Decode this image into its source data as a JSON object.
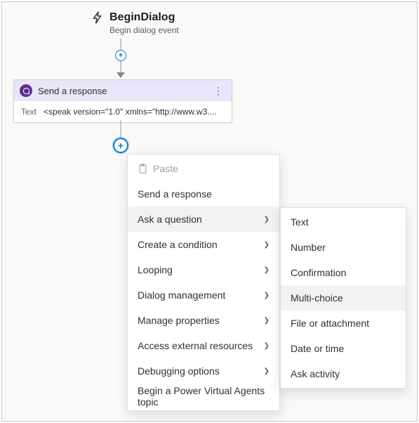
{
  "trigger": {
    "title": "BeginDialog",
    "subtitle": "Begin dialog event"
  },
  "node": {
    "title": "Send a response",
    "field_label": "Text",
    "field_value": "<speak version=\"1.0\" xmlns=\"http://www.w3...."
  },
  "menu": {
    "paste": "Paste",
    "items": [
      {
        "label": "Send a response",
        "submenu": false,
        "hover": false
      },
      {
        "label": "Ask a question",
        "submenu": true,
        "hover": true
      },
      {
        "label": "Create a condition",
        "submenu": true,
        "hover": false
      },
      {
        "label": "Looping",
        "submenu": true,
        "hover": false
      },
      {
        "label": "Dialog management",
        "submenu": true,
        "hover": false
      },
      {
        "label": "Manage properties",
        "submenu": true,
        "hover": false
      },
      {
        "label": "Access external resources",
        "submenu": true,
        "hover": false
      },
      {
        "label": "Debugging options",
        "submenu": true,
        "hover": false
      },
      {
        "label": "Begin a Power Virtual Agents topic",
        "submenu": false,
        "hover": false
      }
    ]
  },
  "submenu": {
    "items": [
      {
        "label": "Text",
        "hover": false
      },
      {
        "label": "Number",
        "hover": false
      },
      {
        "label": "Confirmation",
        "hover": false
      },
      {
        "label": "Multi-choice",
        "hover": true
      },
      {
        "label": "File or attachment",
        "hover": false
      },
      {
        "label": "Date or time",
        "hover": false
      },
      {
        "label": "Ask activity",
        "hover": false
      }
    ]
  }
}
